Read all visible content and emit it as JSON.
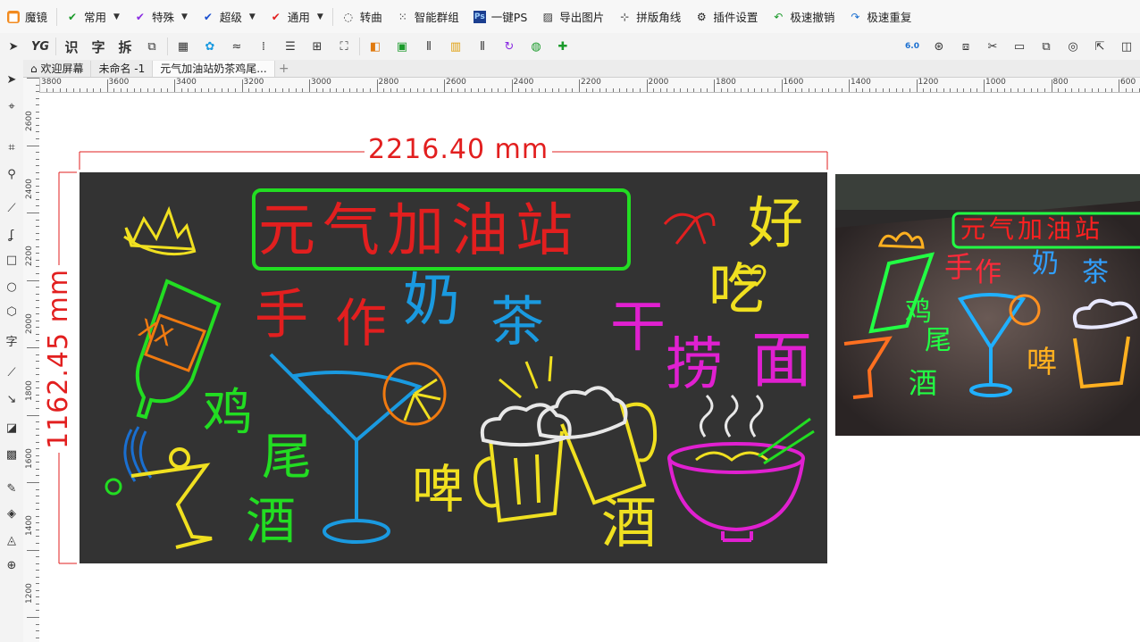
{
  "menubar": {
    "items": [
      {
        "label": "魔镜",
        "icon": "magic-mirror-icon",
        "has_caret": false,
        "color": "#f28b20"
      },
      {
        "label": "常用",
        "icon": "check-arrow-icon",
        "has_caret": true,
        "color": "#1a9a2a"
      },
      {
        "label": "特殊",
        "icon": "check-arrow-icon",
        "has_caret": true,
        "color": "#8a2be2"
      },
      {
        "label": "超级",
        "icon": "check-arrow-icon",
        "has_caret": true,
        "color": "#1a4fd0"
      },
      {
        "label": "通用",
        "icon": "check-arrow-icon",
        "has_caret": true,
        "color": "#e21f1f"
      },
      {
        "label": "转曲",
        "icon": "curve-convert-icon",
        "has_caret": false,
        "color": "#333333"
      },
      {
        "label": "智能群组",
        "icon": "smart-group-icon",
        "has_caret": false,
        "color": "#333333"
      },
      {
        "label": "一键PS",
        "icon": "photoshop-icon",
        "has_caret": false,
        "color": "#1b3e8f"
      },
      {
        "label": "导出图片",
        "icon": "image-export-icon",
        "has_caret": false,
        "color": "#333333"
      },
      {
        "label": "拼版角线",
        "icon": "crop-marks-icon",
        "has_caret": false,
        "color": "#333333"
      },
      {
        "label": "插件设置",
        "icon": "gear-icon",
        "has_caret": false,
        "color": "#222222"
      },
      {
        "label": "极速撤销",
        "icon": "undo-icon",
        "has_caret": false,
        "color": "#1a9a2a"
      },
      {
        "label": "极速重复",
        "icon": "redo-icon",
        "has_caret": false,
        "color": "#1a6fd0"
      }
    ]
  },
  "tabs": [
    {
      "label": "欢迎屏幕",
      "icon": "home-icon",
      "active": false
    },
    {
      "label": "未命名 -1",
      "active": false
    },
    {
      "label": "元气加油站奶茶鸡尾...",
      "active": true
    }
  ],
  "hruler": {
    "labels": [
      "3800",
      "3600",
      "3400",
      "3200",
      "3000",
      "2800",
      "2600",
      "2400",
      "2200",
      "2000",
      "1800",
      "1600",
      "1400",
      "1200",
      "1000",
      "800",
      "600"
    ]
  },
  "vruler": {
    "labels": [
      "2600",
      "2400",
      "2200",
      "2000",
      "1800",
      "1600",
      "1400",
      "1200"
    ]
  },
  "dimensions": {
    "width": "2216.40 mm",
    "height": "1162.45 mm",
    "color": "#e21f1f"
  },
  "neon": {
    "title": "元气加油站",
    "title_color": "#e21f1f",
    "frame_color": "#22dd22",
    "words": [
      {
        "text": "手",
        "color": "#e21f1f"
      },
      {
        "text": "作",
        "color": "#e21f1f"
      },
      {
        "text": "奶",
        "color": "#1a9ae0"
      },
      {
        "text": "茶",
        "color": "#1a9ae0"
      },
      {
        "text": "干",
        "color": "#e020d0"
      },
      {
        "text": "捞",
        "color": "#e020d0"
      },
      {
        "text": "面",
        "color": "#e020d0"
      },
      {
        "text": "好",
        "color": "#f0e020"
      },
      {
        "text": "吃",
        "color": "#f0e020"
      },
      {
        "text": "鸡",
        "color": "#22dd22"
      },
      {
        "text": "尾",
        "color": "#22dd22"
      },
      {
        "text": "酒",
        "color": "#22dd22"
      },
      {
        "text": "啤",
        "color": "#f0e020"
      },
      {
        "text": "酒",
        "color": "#f0e020"
      }
    ],
    "bottle_label": "XX"
  },
  "board_color": "#333333",
  "photo": {
    "title": "元气加油站",
    "words": [
      "手",
      "作",
      "奶",
      "茶",
      "鸡",
      "尾",
      "酒",
      "啤"
    ]
  }
}
